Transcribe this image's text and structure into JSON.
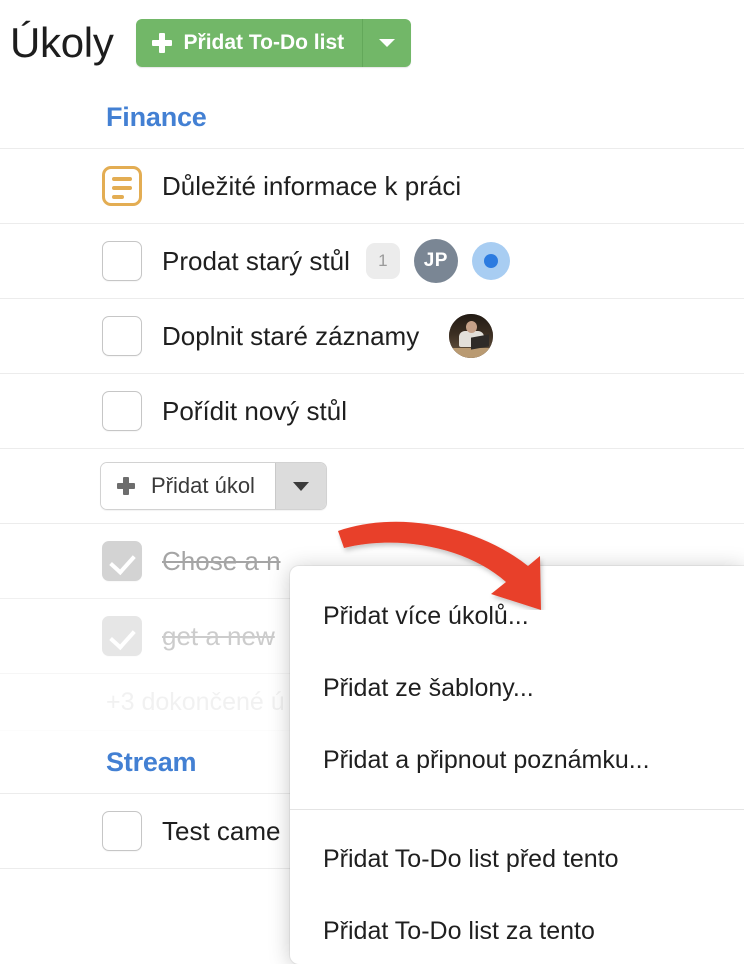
{
  "header": {
    "title": "Úkoly",
    "add_todo_label": "Přidat To-Do list",
    "add_todo_icon": "plus-icon",
    "add_todo_caret_icon": "chevron-down-icon"
  },
  "colors": {
    "green_button": "#72b768",
    "section_blue": "#4380d3",
    "arrow_red": "#e8412b",
    "note_orange": "#e3ad53",
    "avatar_gray": "#7a8694",
    "record_light_blue": "#a8cdf2",
    "record_dot_blue": "#2c7be0"
  },
  "sections": [
    {
      "title": "Finance",
      "rows": [
        {
          "type": "note",
          "icon": "note-document-icon",
          "label": "Důležité informace k práci",
          "badge": null,
          "avatar_initials": null,
          "avatar_photo": false,
          "record": false,
          "completed": false
        },
        {
          "type": "task",
          "icon": "checkbox-unchecked-icon",
          "label": "Prodat starý stůl",
          "badge": "1",
          "avatar_initials": "JP",
          "avatar_photo": false,
          "record": true,
          "completed": false
        },
        {
          "type": "task",
          "icon": "checkbox-unchecked-icon",
          "label": "Doplnit staré záznamy",
          "badge": null,
          "avatar_initials": null,
          "avatar_photo": true,
          "record": false,
          "completed": false
        },
        {
          "type": "task",
          "icon": "checkbox-unchecked-icon",
          "label": "Pořídit nový stůl",
          "badge": null,
          "avatar_initials": null,
          "avatar_photo": false,
          "record": false,
          "completed": false
        }
      ],
      "add_task": {
        "label": "Přidat úkol",
        "icon": "plus-icon",
        "caret_icon": "chevron-down-icon"
      },
      "completed_rows": [
        {
          "icon": "checkbox-checked-icon",
          "label": "Chose a n"
        },
        {
          "icon": "checkbox-checked-icon",
          "label": "get a new"
        }
      ],
      "more_completed": "+3 dokončené ú"
    },
    {
      "title": "Stream",
      "rows": [
        {
          "type": "task",
          "icon": "checkbox-unchecked-icon",
          "label": "Test came",
          "badge": null,
          "avatar_initials": null,
          "avatar_photo": false,
          "record": false,
          "completed": false
        }
      ]
    }
  ],
  "dropdown_menu": {
    "groups": [
      {
        "items": [
          "Přidat více úkolů...",
          "Přidat ze šablony...",
          "Přidat a připnout poznámku..."
        ]
      },
      {
        "items": [
          "Přidat To-Do list před tento",
          "Přidat To-Do list za tento"
        ]
      }
    ]
  },
  "annotation": {
    "arrow_icon": "curved-arrow-icon"
  }
}
